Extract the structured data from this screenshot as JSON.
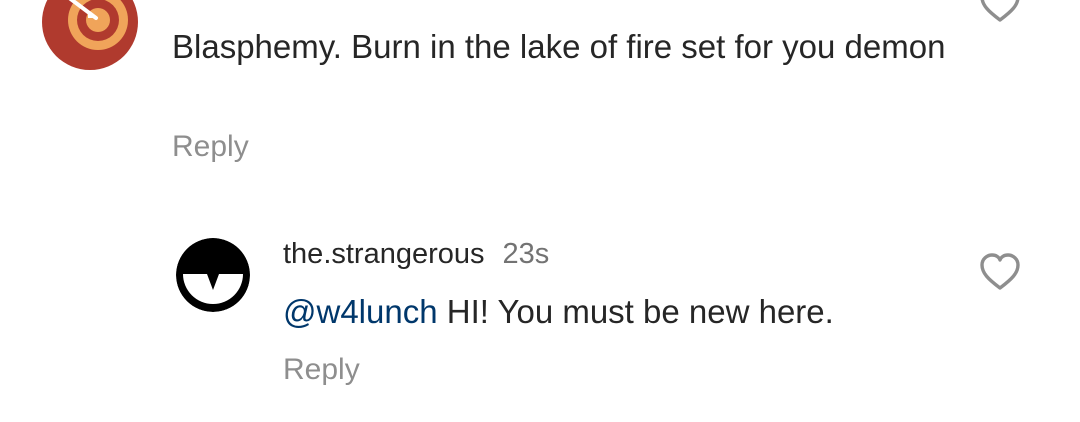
{
  "comments": [
    {
      "avatar_icon": "dartboard-target-icon",
      "text": "Blasphemy. Burn in the lake of fire set for you demon",
      "reply_label": "Reply",
      "like_icon": "heart-outline-icon"
    },
    {
      "avatar_icon": "half-face-eye-icon",
      "username": "the.strangerous",
      "timestamp": "23s",
      "mention": "@w4lunch",
      "text": " HI! You must be new here.",
      "reply_label": "Reply",
      "like_icon": "heart-outline-icon"
    }
  ],
  "colors": {
    "text_primary": "#262626",
    "text_secondary": "#8e8e8e",
    "mention": "#00376b",
    "avatar1_bg": "#b03a2e",
    "avatar1_target": "#f0a45a"
  }
}
